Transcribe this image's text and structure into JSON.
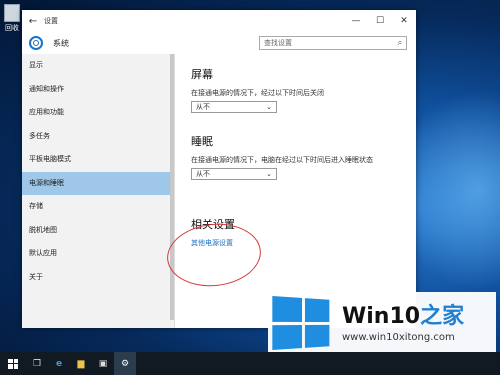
{
  "desktop": {
    "icon_label": "回收"
  },
  "window": {
    "title": "设置",
    "back_glyph": "←",
    "minimize_glyph": "—",
    "maximize_glyph": "☐",
    "close_glyph": "✕"
  },
  "header": {
    "title": "系统",
    "search_placeholder": "查找设置",
    "search_icon": "⌕"
  },
  "sidebar": {
    "items": [
      {
        "label": "显示"
      },
      {
        "label": "通知和操作"
      },
      {
        "label": "应用和功能"
      },
      {
        "label": "多任务"
      },
      {
        "label": "平板电脑模式"
      },
      {
        "label": "电源和睡眠"
      },
      {
        "label": "存储"
      },
      {
        "label": "脱机地图"
      },
      {
        "label": "默认应用"
      },
      {
        "label": "关于"
      }
    ],
    "active_index": 5
  },
  "screen": {
    "title": "屏幕",
    "desc": "在接通电源的情况下，经过以下时间后关闭",
    "value": "从不"
  },
  "sleep": {
    "title": "睡眠",
    "desc": "在接通电源的情况下，电脑在经过以下时间后进入睡眠状态",
    "value": "从不"
  },
  "related": {
    "title": "相关设置",
    "link": "其他电源设置"
  },
  "taskbar": {
    "icons": [
      "start-icon",
      "task-view-icon",
      "edge-icon",
      "file-explorer-icon",
      "store-icon",
      "settings-icon"
    ]
  },
  "brand": {
    "name_prefix": "Win10",
    "name_suffix": "之家",
    "url": "www.win10xitong.com"
  },
  "colors": {
    "accent": "#1a72c9",
    "active_nav": "#9fc7ea",
    "link": "#1a6fc4",
    "annotation_circle": "#d63a3a"
  }
}
